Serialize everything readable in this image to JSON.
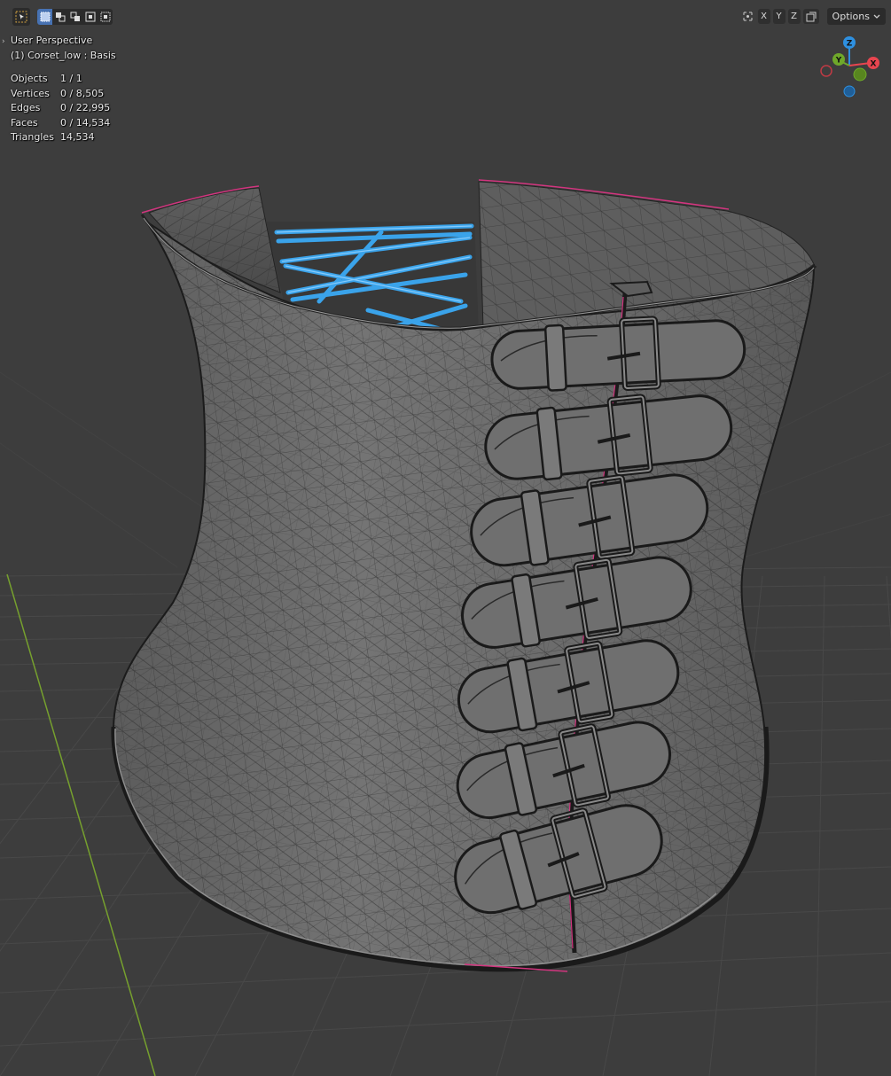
{
  "viewport": {
    "perspective": "User Perspective",
    "object_label": "(1) Corset_low : Basis",
    "stats": [
      {
        "key": "Objects",
        "value": "1 / 1"
      },
      {
        "key": "Vertices",
        "value": "0 / 8,505"
      },
      {
        "key": "Edges",
        "value": "0 / 22,995"
      },
      {
        "key": "Faces",
        "value": "0 / 14,534"
      },
      {
        "key": "Triangles",
        "value": "14,534"
      }
    ]
  },
  "header": {
    "options_label": "Options",
    "mirror_axes": [
      "X",
      "Y",
      "Z"
    ],
    "select_modes": [
      "set",
      "extend",
      "subtract",
      "invert",
      "intersect"
    ]
  },
  "gizmo": {
    "axes": {
      "z": "Z",
      "y": "Y",
      "x": "X"
    },
    "colors": {
      "x": "#e8454f",
      "y": "#6fa82a",
      "z": "#2e90e0"
    }
  },
  "colors": {
    "background": "#3d3d3d",
    "grid": "#4a4a4a",
    "y_axis_line": "#76a02e",
    "mesh_fill": "#6b6b6b",
    "wire": "#1e1e1e",
    "lacing": "#3aa3ea",
    "seam": "#d2357f",
    "select_active": "#4772b3"
  },
  "icons": [
    "select-tool-icon",
    "select-mode-set-icon",
    "select-mode-extend-icon",
    "select-mode-subtract-icon",
    "select-mode-invert-icon",
    "select-mode-intersect-icon",
    "mirror-icon",
    "chevron-down-icon"
  ]
}
